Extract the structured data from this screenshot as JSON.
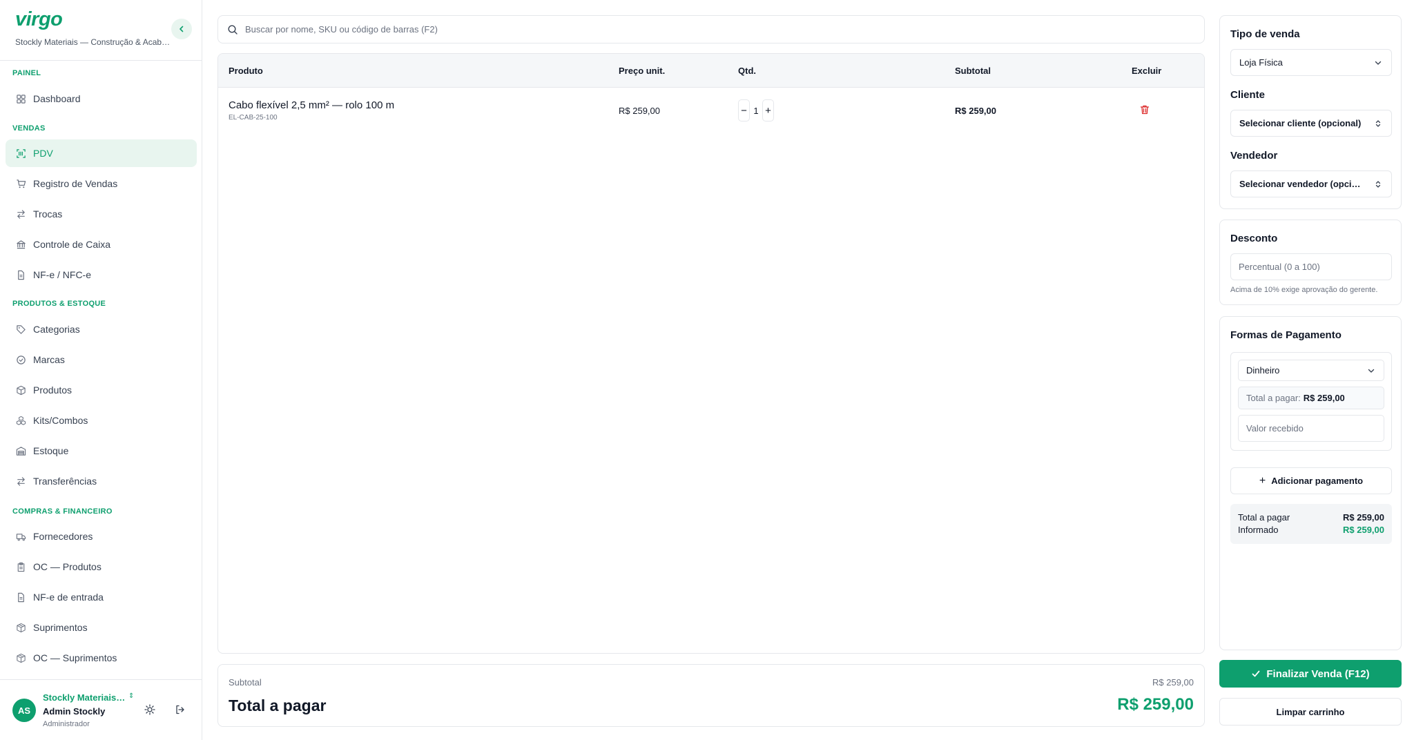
{
  "brand": {
    "logo": "virgo",
    "subtitle": "Stockly Materiais — Construção & Acabamentos"
  },
  "sidebar": {
    "sections": [
      {
        "title": "PAINEL",
        "items": [
          {
            "label": "Dashboard",
            "icon": "grid-icon"
          }
        ]
      },
      {
        "title": "VENDAS",
        "items": [
          {
            "label": "PDV",
            "icon": "scan-icon",
            "active": true
          },
          {
            "label": "Registro de Vendas",
            "icon": "cart-icon"
          },
          {
            "label": "Trocas",
            "icon": "swap-icon"
          },
          {
            "label": "Controle de Caixa",
            "icon": "bank-icon"
          },
          {
            "label": "NF-e / NFC-e",
            "icon": "document-icon"
          }
        ]
      },
      {
        "title": "PRODUTOS & ESTOQUE",
        "items": [
          {
            "label": "Categorias",
            "icon": "tag-icon"
          },
          {
            "label": "Marcas",
            "icon": "badge-icon"
          },
          {
            "label": "Produtos",
            "icon": "box-icon"
          },
          {
            "label": "Kits/Combos",
            "icon": "boxes-icon"
          },
          {
            "label": "Estoque",
            "icon": "warehouse-icon"
          },
          {
            "label": "Transferências",
            "icon": "swap-icon"
          }
        ]
      },
      {
        "title": "COMPRAS & FINANCEIRO",
        "items": [
          {
            "label": "Fornecedores",
            "icon": "truck-icon"
          },
          {
            "label": "OC — Produtos",
            "icon": "clipboard-icon"
          },
          {
            "label": "NF-e de entrada",
            "icon": "document-icon"
          },
          {
            "label": "Suprimentos",
            "icon": "package-icon"
          },
          {
            "label": "OC — Suprimentos",
            "icon": "package-icon"
          }
        ]
      }
    ]
  },
  "user": {
    "initials": "AS",
    "org": "Stockly Materiais Construção",
    "name": "Admin Stockly",
    "role": "Administrador"
  },
  "search": {
    "placeholder": "Buscar por nome, SKU ou código de barras (F2)"
  },
  "table": {
    "headers": {
      "product": "Produto",
      "price": "Preço unit.",
      "qty": "Qtd.",
      "subtotal": "Subtotal",
      "delete": "Excluir"
    },
    "rows": [
      {
        "name": "Cabo flexível 2,5 mm² — rolo 100 m",
        "sku": "EL-CAB-25-100",
        "price": "R$ 259,00",
        "qty": "1",
        "subtotal": "R$ 259,00"
      }
    ]
  },
  "totals": {
    "subtotal_label": "Subtotal",
    "subtotal_value": "R$ 259,00",
    "total_label": "Total a pagar",
    "total_value": "R$ 259,00"
  },
  "sale": {
    "type_label": "Tipo de venda",
    "type_value": "Loja Física",
    "client_label": "Cliente",
    "client_value": "Selecionar cliente (opcional)",
    "seller_label": "Vendedor",
    "seller_value": "Selecionar vendedor (opcional)"
  },
  "discount": {
    "label": "Desconto",
    "placeholder": "Percentual (0 a 100)",
    "hint": "Acima de 10% exige aprovação do gerente."
  },
  "payment": {
    "label": "Formas de Pagamento",
    "method": "Dinheiro",
    "total_label": "Total a pagar:",
    "total_value": "R$ 259,00",
    "received_placeholder": "Valor recebido",
    "add_label": "Adicionar pagamento",
    "summary": {
      "due_label": "Total a pagar",
      "due_value": "R$ 259,00",
      "informed_label": "Informado",
      "informed_value": "R$ 259,00"
    }
  },
  "actions": {
    "finalize": "Finalizar Venda (F12)",
    "clear": "Limpar carrinho"
  },
  "colors": {
    "accent": "#0e9f6e",
    "danger": "#dc2626",
    "border": "#e5e7eb"
  }
}
